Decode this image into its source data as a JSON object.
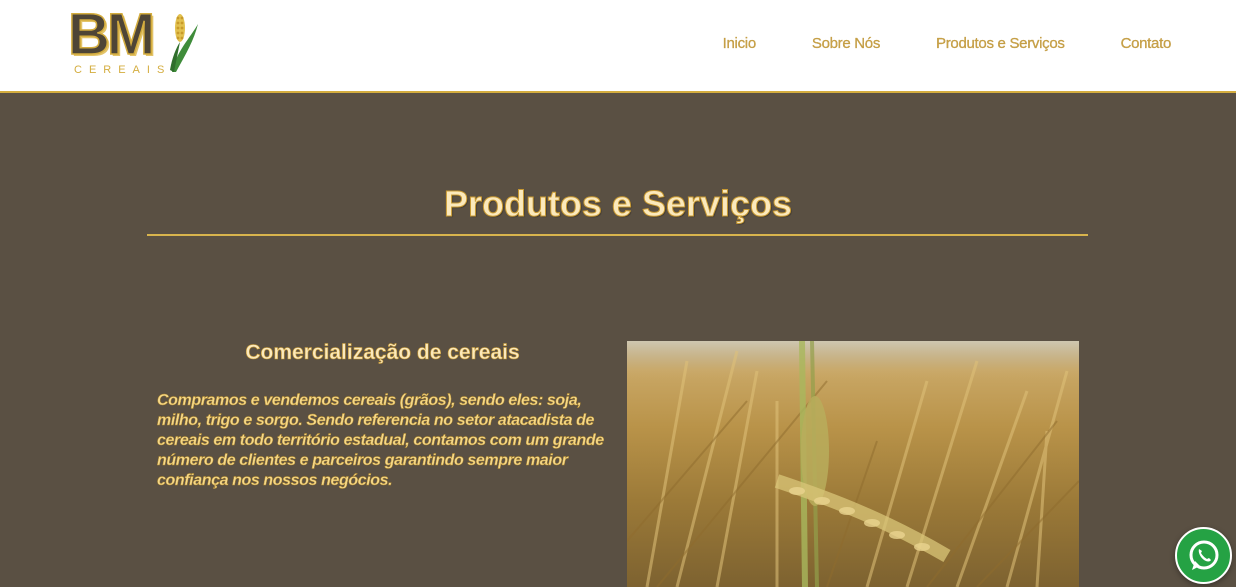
{
  "logo": {
    "mark": "BM",
    "subtitle": "CEREAIS",
    "icon": "corn-leaf-icon"
  },
  "nav": {
    "items": [
      {
        "label": "Inicio"
      },
      {
        "label": "Sobre Nós"
      },
      {
        "label": "Produtos e Serviços"
      },
      {
        "label": "Contato"
      }
    ]
  },
  "section": {
    "title": "Produtos e Serviços"
  },
  "card": {
    "title": "Comercialização de cereais",
    "text": "Compramos e vendemos cereais (grãos), sendo eles: soja, milho, trigo e sorgo. Sendo referencia no setor atacadista de cereais em todo território estadual, contamos com um grande número de clientes e parceiros garantindo sempre maior confiança nos nossos negócios.",
    "image": "wheat-field-photo"
  },
  "floating": {
    "icon": "whatsapp-icon"
  },
  "colors": {
    "header_bg": "#ffffff",
    "page_bg": "#5a5043",
    "accent": "#d4ad3f",
    "heading": "#fbe9bc",
    "body_text": "#f4d88a",
    "whatsapp": "#25a244"
  }
}
